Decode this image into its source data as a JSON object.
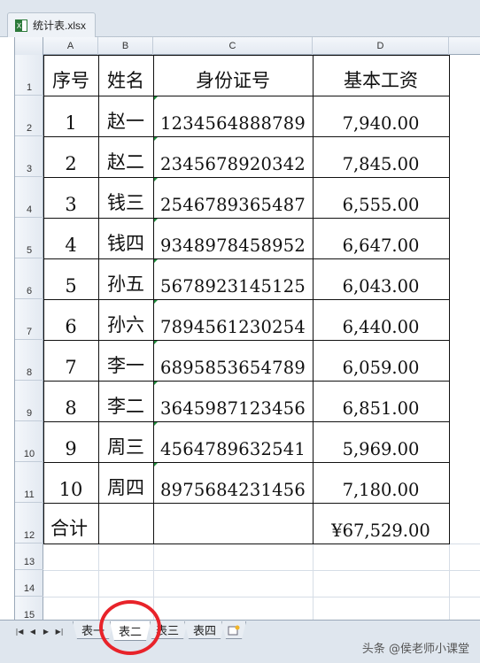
{
  "window": {
    "title": "统计表.xlsx",
    "icon": "excel-file-icon"
  },
  "columns": [
    "A",
    "B",
    "C",
    "D"
  ],
  "rows": [
    "1",
    "2",
    "3",
    "4",
    "5",
    "6",
    "7",
    "8",
    "9",
    "10",
    "11",
    "12",
    "13",
    "14",
    "15"
  ],
  "table": {
    "headers": [
      "序号",
      "姓名",
      "身份证号",
      "基本工资"
    ],
    "records": [
      [
        "1",
        "赵一",
        "1234564888789",
        "7,940.00"
      ],
      [
        "2",
        "赵二",
        "2345678920342",
        "7,845.00"
      ],
      [
        "3",
        "钱三",
        "2546789365487",
        "6,555.00"
      ],
      [
        "4",
        "钱四",
        "9348978458952",
        "6,647.00"
      ],
      [
        "5",
        "孙五",
        "5678923145125",
        "6,043.00"
      ],
      [
        "6",
        "孙六",
        "7894561230254",
        "6,440.00"
      ],
      [
        "7",
        "李一",
        "6895853654789",
        "6,059.00"
      ],
      [
        "8",
        "李二",
        "3645987123456",
        "6,851.00"
      ],
      [
        "9",
        "周三",
        "4564789632541",
        "5,969.00"
      ],
      [
        "10",
        "周四",
        "8975684231456",
        "7,180.00"
      ]
    ],
    "total_label": "合计",
    "total_value": "¥67,529.00"
  },
  "sheets": {
    "tabs": [
      "表一",
      "表二",
      "表三",
      "表四"
    ],
    "active": "表二",
    "new_sheet_icon": "insert-sheet-icon"
  },
  "nav_icons": [
    "first-sheet-icon",
    "prev-sheet-icon",
    "next-sheet-icon",
    "last-sheet-icon"
  ],
  "watermark": "头条 @侯老师小课堂",
  "colors": {
    "highlight_circle": "#e8232a",
    "error_triangle": "#1e8c3a"
  }
}
